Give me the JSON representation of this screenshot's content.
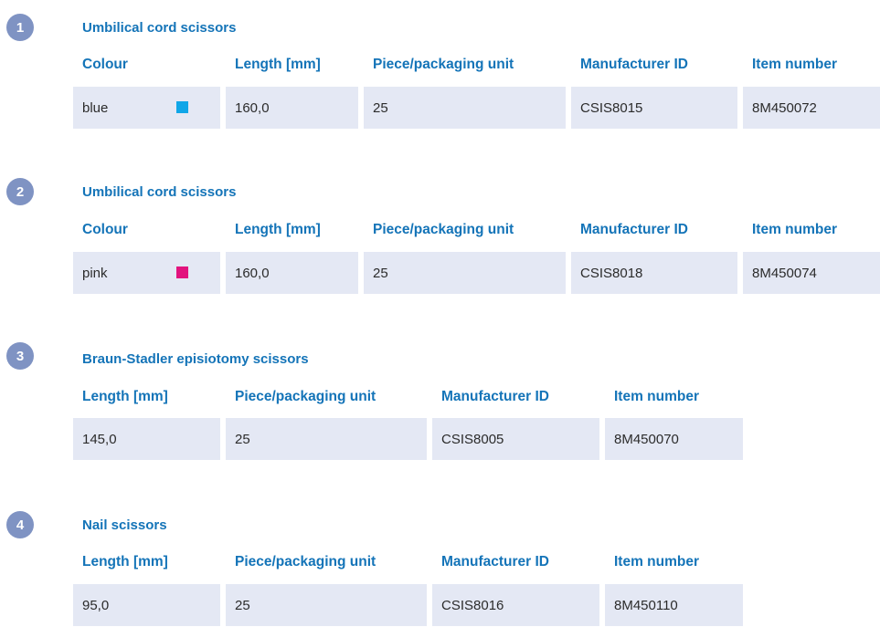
{
  "sections": [
    {
      "number": "1",
      "title": "Umbilical cord scissors",
      "headers": [
        "Colour",
        "Length [mm]",
        "Piece/packaging unit",
        "Manufacturer ID",
        "Item number"
      ],
      "row": {
        "colour": "blue",
        "colour_hex": "#10a6e8",
        "length": "160,0",
        "pieces": "25",
        "manufacturer_id": "CSIS8015",
        "item_number": "8M450072"
      }
    },
    {
      "number": "2",
      "title": "Umbilical cord scissors",
      "headers": [
        "Colour",
        "Length [mm]",
        "Piece/packaging unit",
        "Manufacturer ID",
        "Item number"
      ],
      "row": {
        "colour": "pink",
        "colour_hex": "#e2137e",
        "length": "160,0",
        "pieces": "25",
        "manufacturer_id": "CSIS8018",
        "item_number": "8M450074"
      }
    },
    {
      "number": "3",
      "title": "Braun-Stadler episiotomy scissors",
      "headers": [
        "Length [mm]",
        "Piece/packaging unit",
        "Manufacturer ID",
        "Item number"
      ],
      "row": {
        "length": "145,0",
        "pieces": "25",
        "manufacturer_id": "CSIS8005",
        "item_number": "8M450070"
      }
    },
    {
      "number": "4",
      "title": "Nail scissors",
      "headers": [
        "Length [mm]",
        "Piece/packaging unit",
        "Manufacturer ID",
        "Item number"
      ],
      "row": {
        "length": "95,0",
        "pieces": "25",
        "manufacturer_id": "CSIS8016",
        "item_number": "8M450110"
      }
    }
  ],
  "colors": {
    "accent": "#1474b8",
    "badge": "#7f93c3",
    "cell_bg": "#e4e8f4"
  }
}
